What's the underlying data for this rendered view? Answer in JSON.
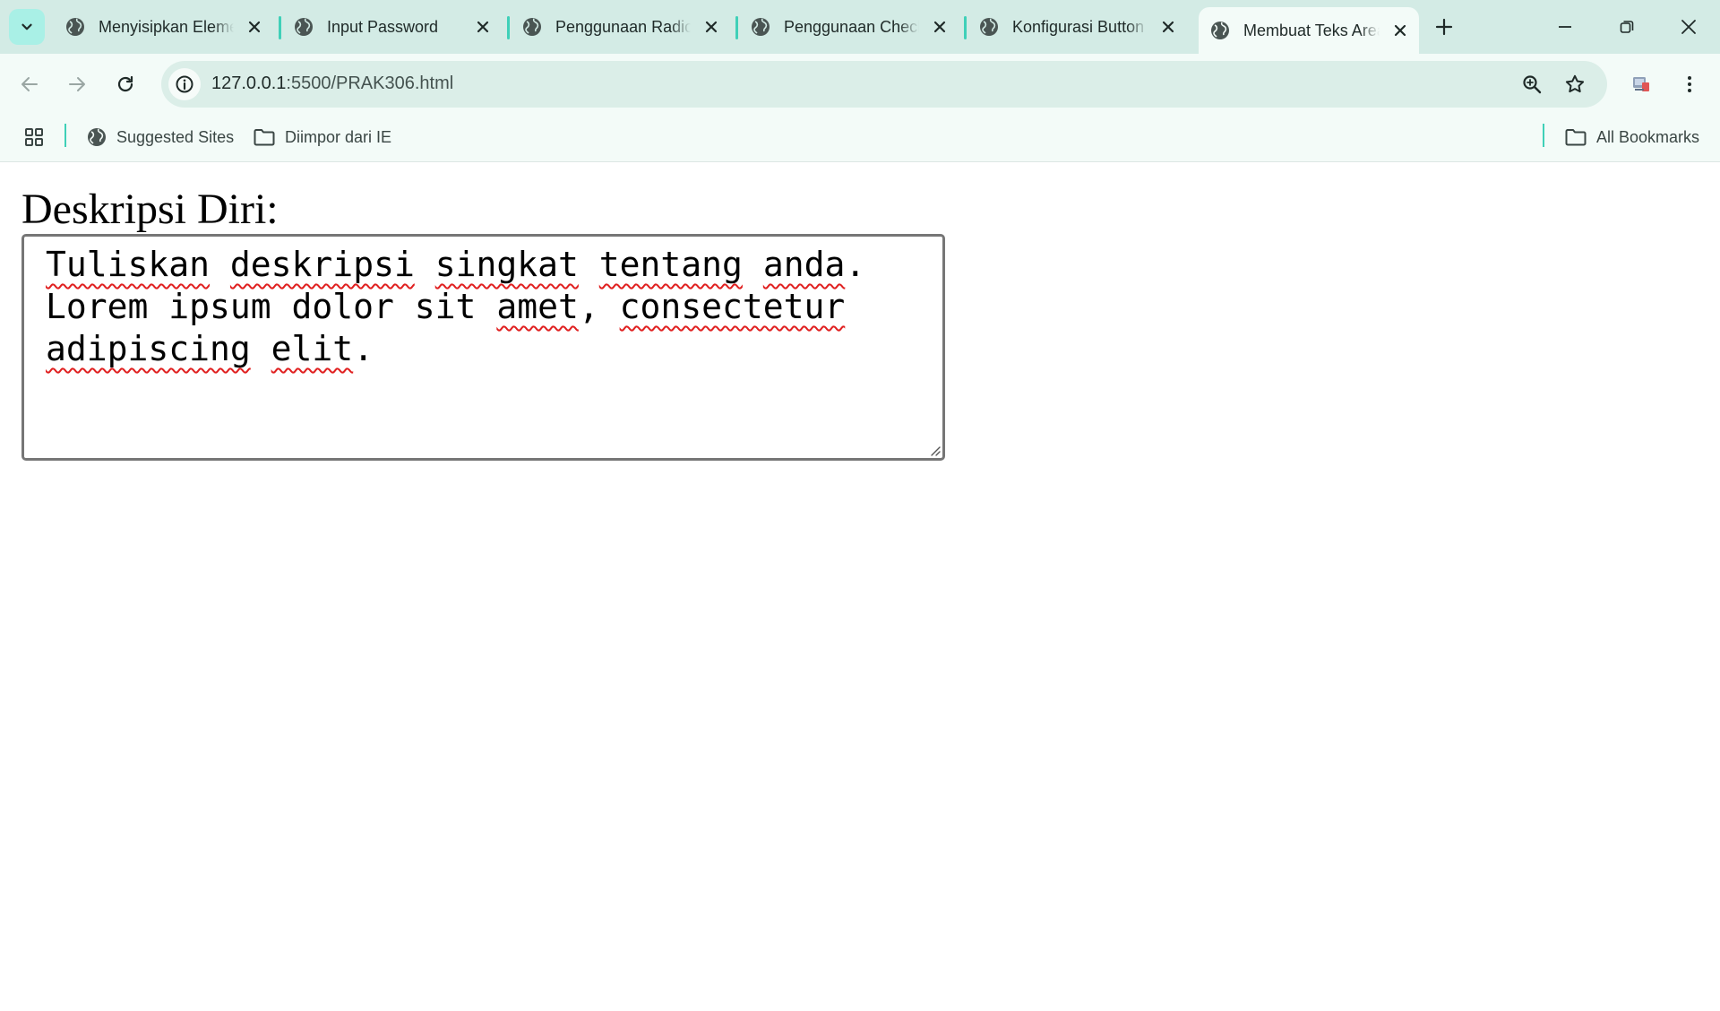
{
  "tabs": [
    {
      "title": "Menyisipkan Elemen"
    },
    {
      "title": "Input Password"
    },
    {
      "title": "Penggunaan Radio"
    },
    {
      "title": "Penggunaan Checkbox"
    },
    {
      "title": "Konfigurasi Button"
    },
    {
      "title": "Membuat Teks Area",
      "active": true
    }
  ],
  "address_bar": {
    "host": "127.0.0.1",
    "path": ":5500/PRAK306.html"
  },
  "bookmarks": {
    "suggested_sites": "Suggested Sites",
    "imported": "Diimpor dari IE",
    "all_bookmarks": "All Bookmarks"
  },
  "page": {
    "label": "Deskripsi Diri:",
    "textarea": {
      "line1_w1": "Tuliskan",
      "line1_w2": "deskripsi",
      "line1_w3": "singkat",
      "line1_w4": "tentang",
      "line1_w5": "anda",
      "line1_end": ".",
      "line2_w1": "Lorem ipsum dolor sit",
      "line2_w2": "amet",
      "line2_mid": ",",
      "line2_w3": "consectetur",
      "line3_w1": "adipiscing",
      "line3_w2": "elit",
      "line3_end": "."
    }
  },
  "icons": {
    "tab_search": "chevron-down-icon",
    "tab_favicon": "globe-icon",
    "tab_close": "close-icon",
    "new_tab": "plus-icon",
    "minimize": "minimize-icon",
    "restore": "restore-icon",
    "close_window": "close-icon",
    "back": "arrow-left-icon",
    "forward": "arrow-right-icon",
    "reload": "reload-icon",
    "site_info": "info-icon",
    "zoom": "zoom-icon",
    "bookmark_star": "star-icon",
    "extension": "extension-icon",
    "menu": "kebab-menu-icon",
    "apps": "apps-grid-icon",
    "folder": "folder-icon"
  },
  "colors": {
    "tabstrip_bg": "#d3ebe5",
    "toolbar_bg": "#f3fbf8",
    "omnibox_bg": "#dbeee8",
    "accent": "#3fd0b8",
    "spellcheck": "#e02020"
  }
}
